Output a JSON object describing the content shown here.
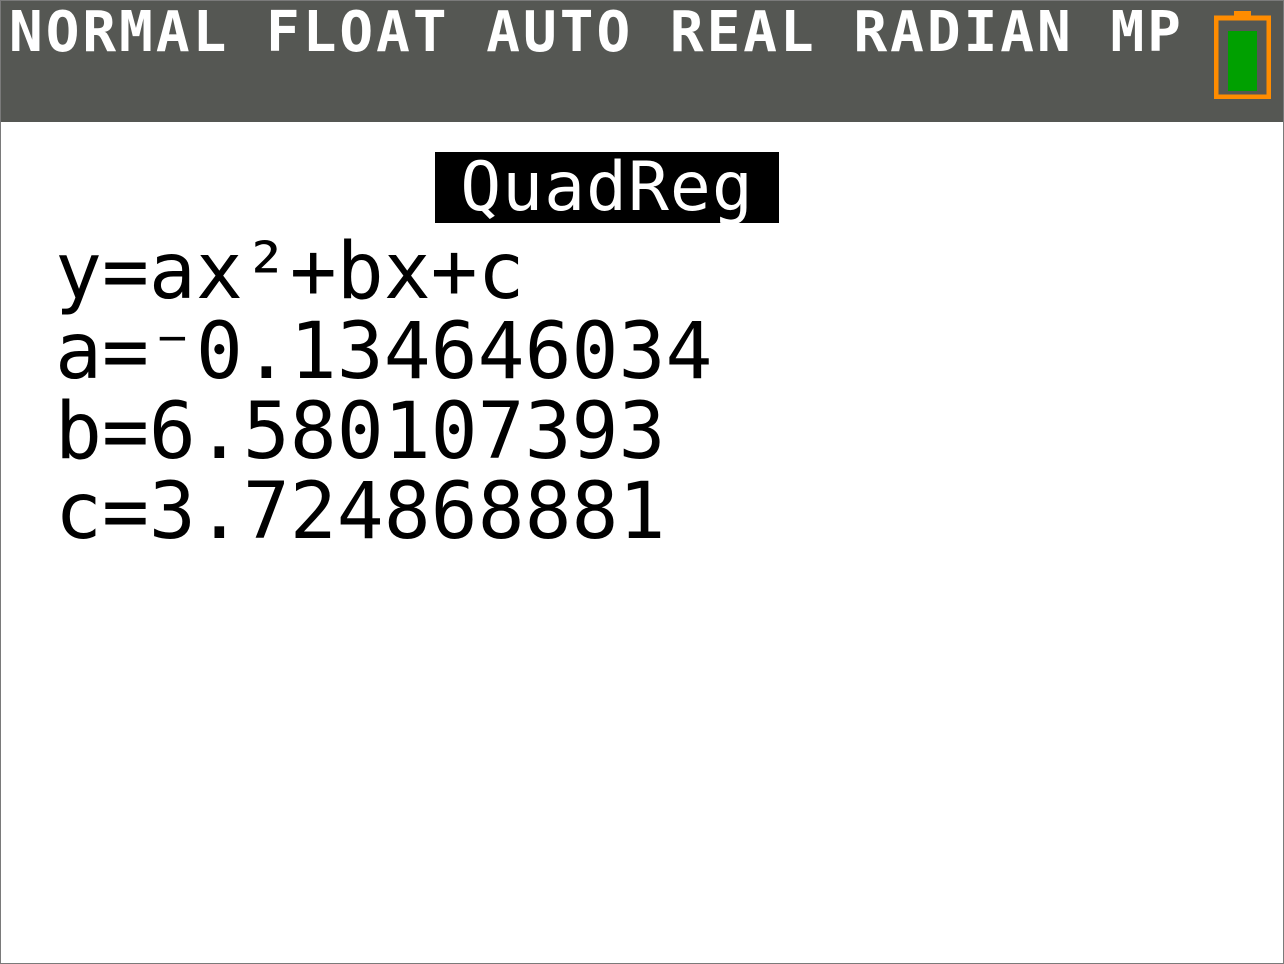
{
  "status": {
    "mode_text": "NORMAL FLOAT AUTO REAL RADIAN MP",
    "battery_icon": "battery-icon",
    "battery_color": "#ff8c00",
    "battery_fill_color": "#00a000"
  },
  "regression": {
    "title": "QuadReg",
    "equation": "y=ax²+bx+c",
    "a_line": "a=⁻0.134646034",
    "b_line": "b=6.580107393",
    "c_line": "c=3.724868881"
  }
}
